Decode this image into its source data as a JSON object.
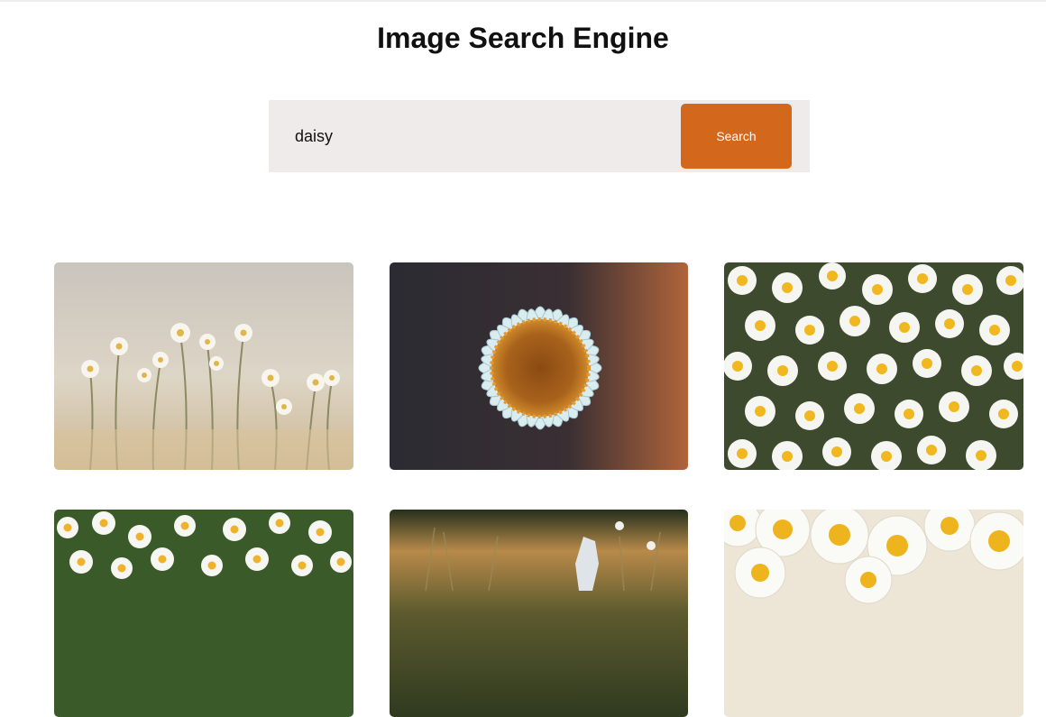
{
  "page": {
    "title": "Image Search Engine"
  },
  "search": {
    "value": "daisy",
    "button_label": "Search"
  },
  "results": [
    {
      "name": "daisy-meadow-misty"
    },
    {
      "name": "daisy-closeup-blue"
    },
    {
      "name": "daisy-field-dense"
    },
    {
      "name": "daisy-field-green"
    },
    {
      "name": "daisy-sunset-grass"
    },
    {
      "name": "daisy-cluster-cream"
    }
  ],
  "colors": {
    "accent": "#d3681d",
    "search_bg": "#efebea"
  }
}
